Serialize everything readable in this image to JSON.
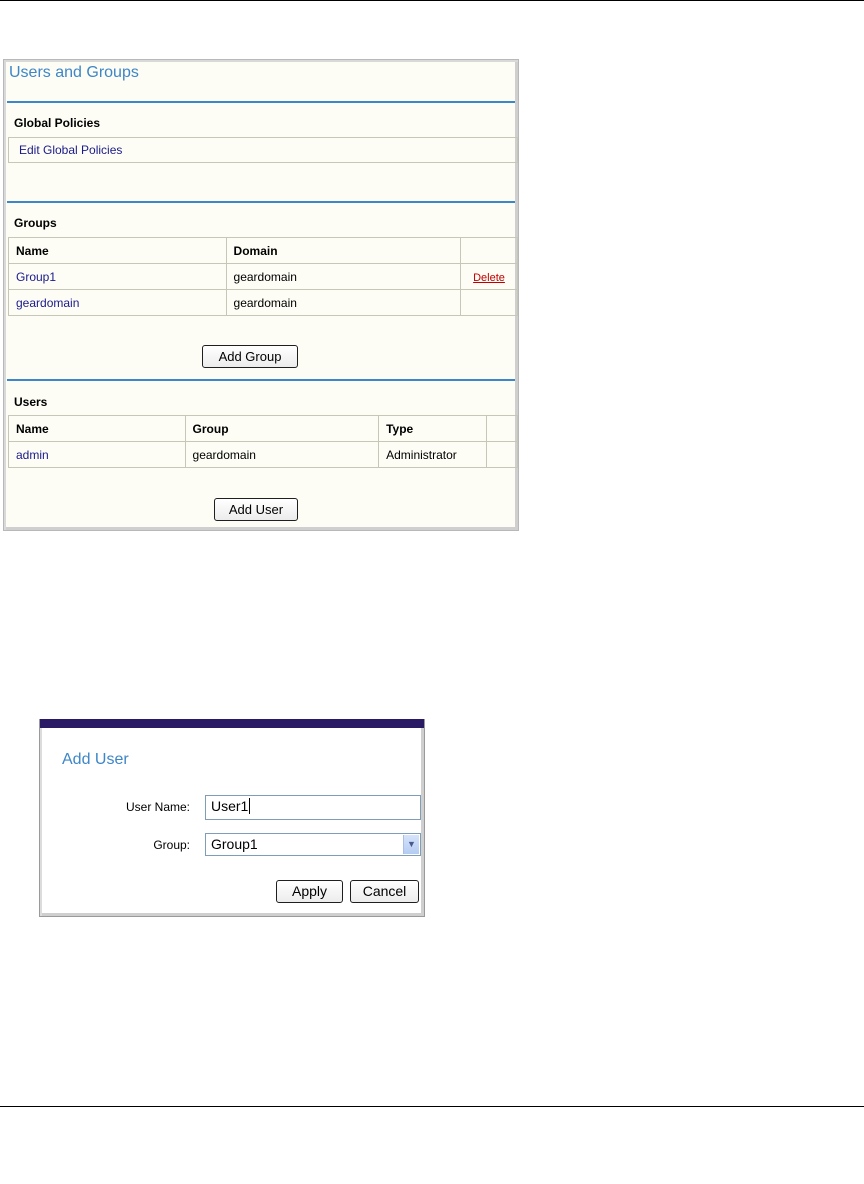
{
  "users_groups_panel": {
    "title": "Users and Groups",
    "global_policies": {
      "heading": "Global Policies",
      "edit_link": "Edit Global Policies"
    },
    "groups": {
      "heading": "Groups",
      "columns": [
        "Name",
        "Domain",
        ""
      ],
      "rows": [
        {
          "name": "Group1",
          "domain": "geardomain",
          "action": "Delete"
        },
        {
          "name": "geardomain",
          "domain": "geardomain",
          "action": ""
        }
      ],
      "add_button": "Add Group"
    },
    "users": {
      "heading": "Users",
      "columns": [
        "Name",
        "Group",
        "Type",
        ""
      ],
      "rows": [
        {
          "name": "admin",
          "group": "geardomain",
          "type": "Administrator"
        }
      ],
      "add_button": "Add User"
    }
  },
  "add_user_dialog": {
    "title": "Add User",
    "user_name_label": "User Name:",
    "user_name_value": "User1",
    "group_label": "Group:",
    "group_selected": "Group1",
    "apply_button": "Apply",
    "cancel_button": "Cancel"
  },
  "colors": {
    "accent_blue": "#3d86c8",
    "link_blue": "#1a1a8c",
    "delete_red": "#c00000",
    "dialog_bar": "#2a1a66"
  }
}
